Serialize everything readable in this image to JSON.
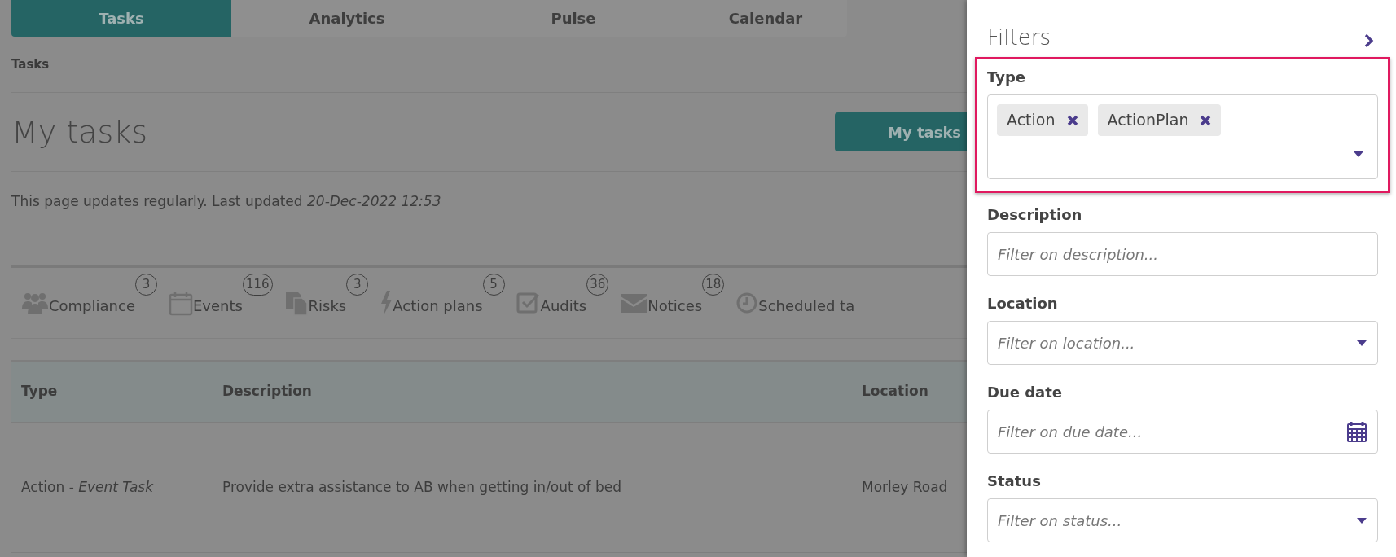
{
  "nav_tabs": [
    {
      "label": "Tasks",
      "selected": true
    },
    {
      "label": "Analytics",
      "selected": false
    },
    {
      "label": "Pulse",
      "selected": false
    },
    {
      "label": "Calendar",
      "selected": false
    }
  ],
  "breadcrumb": "Tasks",
  "page_title": "My tasks",
  "view_button": "My tasks",
  "update_note": "This page updates regularly. Last updated *20-Dec-2022 12:53*",
  "categories": [
    {
      "label": "Compliance",
      "count": "3"
    },
    {
      "label": "Events",
      "count": "116"
    },
    {
      "label": "Risks",
      "count": "3"
    },
    {
      "label": "Action plans",
      "count": "5"
    },
    {
      "label": "Audits",
      "count": "36"
    },
    {
      "label": "Notices",
      "count": "18"
    },
    {
      "label": "Scheduled ta"
    }
  ],
  "table": {
    "columns": [
      "Type",
      "Description",
      "Location"
    ],
    "rows": [
      [
        "Action - *Event Task*",
        "Provide extra assistance to AB when getting in/out of bed",
        "Morley Road"
      ]
    ]
  },
  "filters_panel": {
    "title": "Filters",
    "fields": [
      {
        "kind": "multiselect",
        "label": "Type",
        "highlighted": true,
        "chips": [
          "Action",
          "ActionPlan"
        ]
      },
      {
        "kind": "text",
        "label": "Description",
        "placeholder": "Filter on description..."
      },
      {
        "kind": "select",
        "label": "Location",
        "placeholder": "Filter on location..."
      },
      {
        "kind": "date",
        "label": "Due date",
        "placeholder": "Filter on due date..."
      },
      {
        "kind": "select",
        "label": "Status",
        "placeholder": "Filter on status..."
      }
    ]
  }
}
